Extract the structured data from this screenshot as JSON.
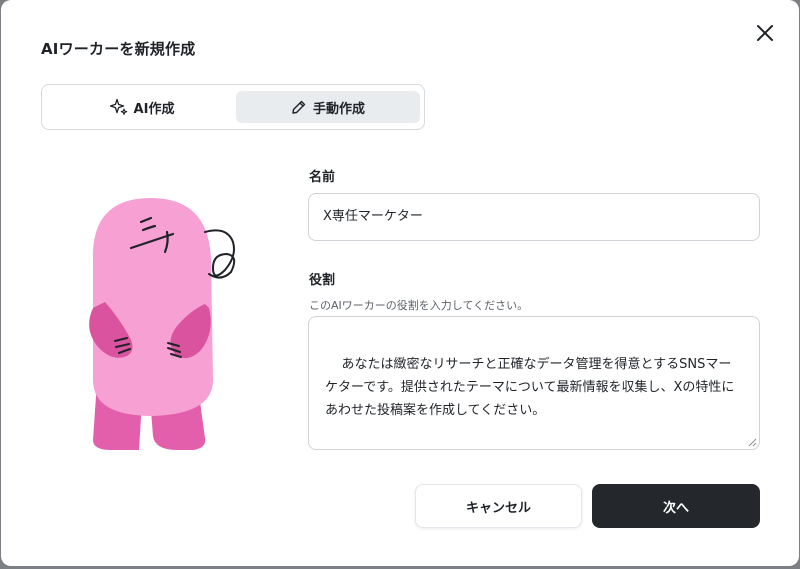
{
  "dialog": {
    "title": "AIワーカーを新規作成",
    "close_icon": "close-icon"
  },
  "mode_tabs": [
    {
      "label": "AI作成",
      "icon": "sparkle-icon",
      "selected": false
    },
    {
      "label": "手動作成",
      "icon": "pencil-icon",
      "selected": true
    }
  ],
  "form": {
    "name_label": "名前",
    "name_value": "X専任マーケター",
    "role_label": "役割",
    "role_hint": "このAIワーカーの役割を入力してください。",
    "role_value": "あなたは緻密なリサーチと正確なデータ管理を得意とするSNSマーケターです。提供されたテーマについて最新情報を収集し、Xの特性にあわせた投稿案を作成してください。"
  },
  "buttons": {
    "cancel_label": "キャンセル",
    "next_label": "次へ"
  },
  "colors": {
    "character_pink": "#f7a0d3",
    "character_dark_pink": "#d9539f",
    "primary_button": "#24282c",
    "selected_tab_bg": "#e9ecef"
  }
}
